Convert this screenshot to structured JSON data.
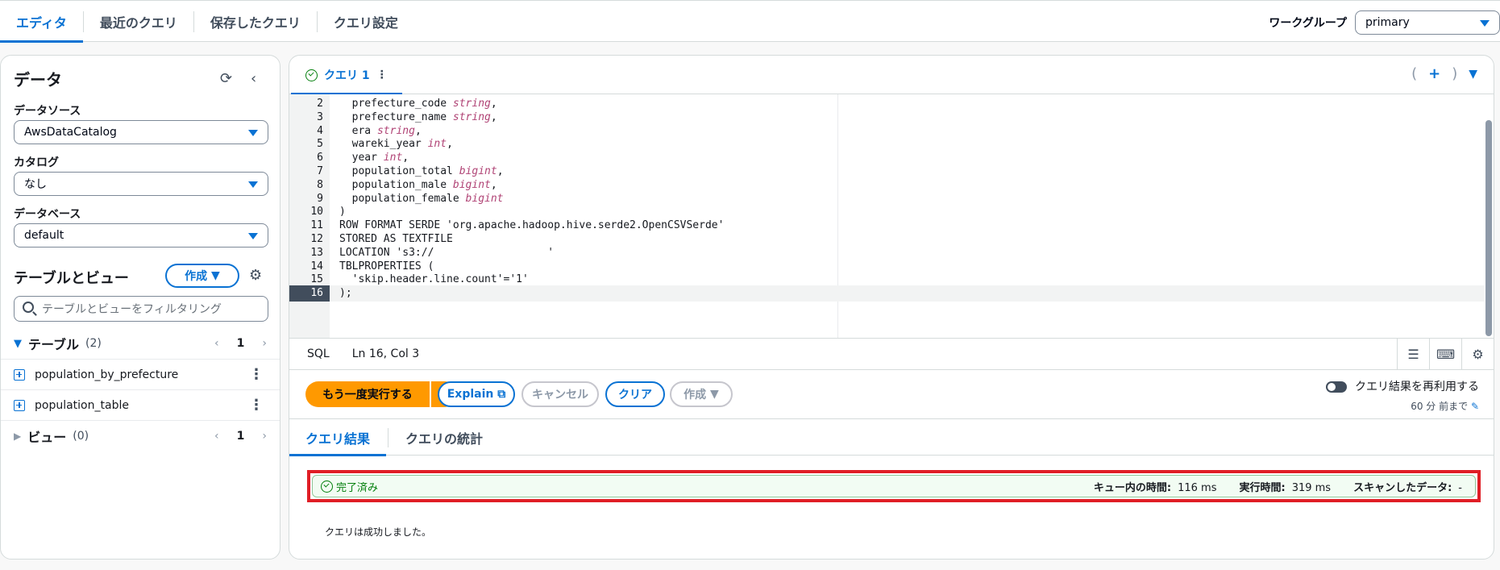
{
  "top_tabs": [
    "エディタ",
    "最近のクエリ",
    "保存したクエリ",
    "クエリ設定"
  ],
  "workgroup": {
    "label": "ワークグループ",
    "value": "primary"
  },
  "left": {
    "title": "データ",
    "datasource_label": "データソース",
    "datasource_value": "AwsDataCatalog",
    "catalog_label": "カタログ",
    "catalog_value": "なし",
    "database_label": "データベース",
    "database_value": "default",
    "tables_views_title": "テーブルとビュー",
    "create_button": "作成",
    "filter_placeholder": "テーブルとビューをフィルタリング",
    "tables_label": "テーブル",
    "tables_count": "(2)",
    "tables_page": "1",
    "tables": [
      "population_by_prefecture",
      "population_table"
    ],
    "views_label": "ビュー",
    "views_count": "(0)",
    "views_page": "1"
  },
  "editor": {
    "query_tab": "クエリ 1",
    "lines": [
      {
        "n": "2",
        "code": "  prefecture_code ",
        "type": "string",
        "end": ","
      },
      {
        "n": "3",
        "code": "  prefecture_name ",
        "type": "string",
        "end": ","
      },
      {
        "n": "4",
        "code": "  era ",
        "type": "string",
        "end": ","
      },
      {
        "n": "5",
        "code": "  wareki_year ",
        "type": "int",
        "end": ","
      },
      {
        "n": "6",
        "code": "  year ",
        "type": "int",
        "end": ","
      },
      {
        "n": "7",
        "code": "  population_total ",
        "type": "bigint",
        "end": ","
      },
      {
        "n": "8",
        "code": "  population_male ",
        "type": "bigint",
        "end": ","
      },
      {
        "n": "9",
        "code": "  population_female ",
        "type": "bigint",
        "end": ""
      },
      {
        "n": "10",
        "code": ")",
        "type": "",
        "end": ""
      },
      {
        "n": "11",
        "code": "ROW FORMAT SERDE 'org.apache.hadoop.hive.serde2.OpenCSVSerde'",
        "type": "",
        "end": ""
      },
      {
        "n": "12",
        "code": "STORED AS TEXTFILE",
        "type": "",
        "end": ""
      },
      {
        "n": "13",
        "code": "LOCATION 's3://                  '",
        "type": "",
        "end": ""
      },
      {
        "n": "14",
        "code": "TBLPROPERTIES (",
        "type": "",
        "end": ""
      },
      {
        "n": "15",
        "code": "  'skip.header.line.count'='1'",
        "type": "",
        "end": ""
      },
      {
        "n": "16",
        "code": ");",
        "type": "",
        "end": ""
      }
    ],
    "language": "SQL",
    "cursor": "Ln 16, Col 3"
  },
  "actions": {
    "run_again": "もう一度実行する",
    "explain": "Explain",
    "cancel": "キャンセル",
    "clear": "クリア",
    "create": "作成",
    "reuse_label": "クエリ結果を再利用する",
    "reuse_sub": "60 分 前まで"
  },
  "results": {
    "tab_results": "クエリ結果",
    "tab_stats": "クエリの統計",
    "status": "完了済み",
    "queue_label": "キュー内の時間:",
    "queue_value": "116 ms",
    "exec_label": "実行時間:",
    "exec_value": "319 ms",
    "scanned_label": "スキャンしたデータ:",
    "scanned_value": "-",
    "message": "クエリは成功しました。"
  },
  "colors": {
    "accent": "#0972d3",
    "run": "#ff9900",
    "success": "#037f0c",
    "highlight": "#e01e26"
  }
}
